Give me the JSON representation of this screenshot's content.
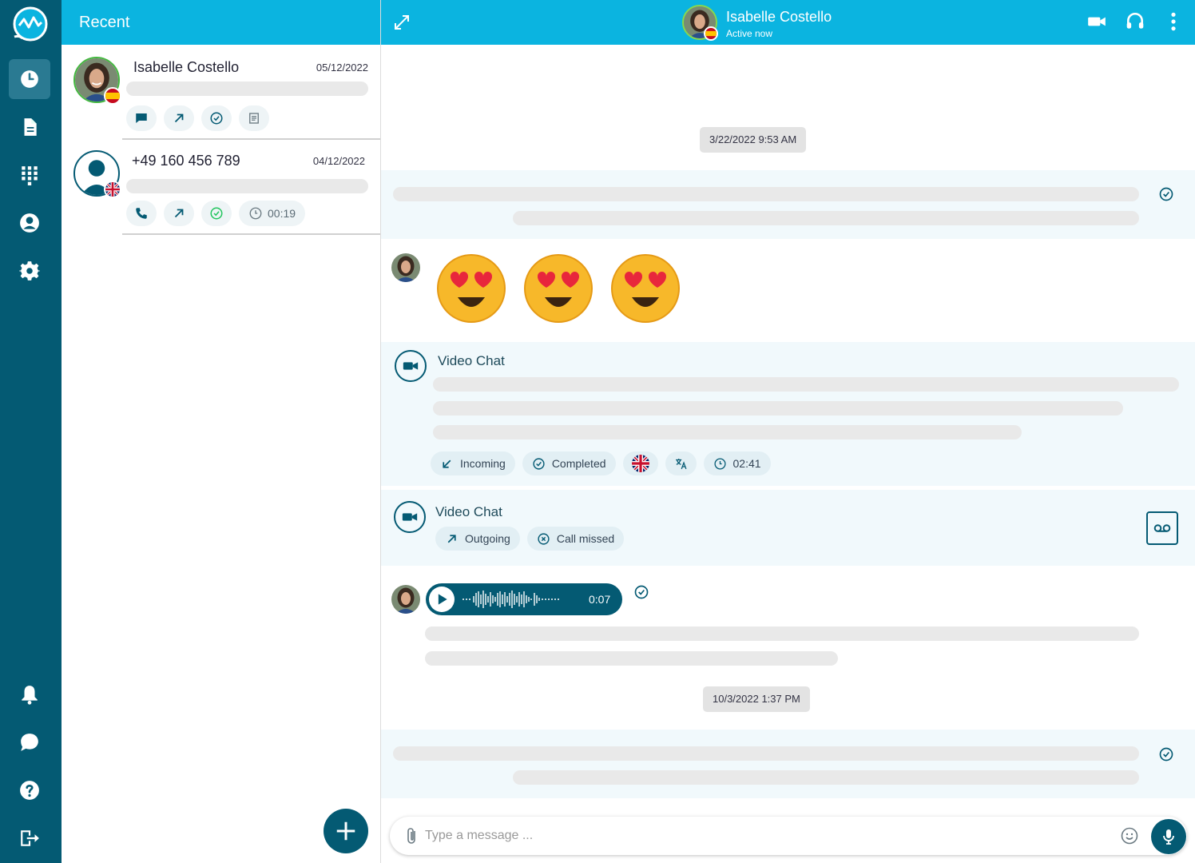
{
  "sidebar": {
    "items": [
      "recent-icon",
      "document-icon",
      "dialpad-icon",
      "user-icon",
      "settings-icon"
    ],
    "bottom_items": [
      "bell-icon",
      "chat-icon",
      "help-icon",
      "logout-icon"
    ]
  },
  "recent": {
    "title": "Recent",
    "contacts": [
      {
        "name": "Isabelle Costello",
        "date": "05/12/2022"
      },
      {
        "name": "+49 160 456 789",
        "date": "04/12/2022",
        "duration": "00:19"
      }
    ]
  },
  "chat": {
    "contact_name": "Isabelle Costello",
    "status": "Active now",
    "date_1": "3/22/2022 9:53 AM",
    "date_2": "10/3/2022 1:37 PM",
    "call_1": {
      "title": "Video Chat",
      "direction": "Incoming",
      "result": "Completed",
      "duration": "02:41"
    },
    "call_2": {
      "title": "Video Chat",
      "direction": "Outgoing",
      "result": "Call missed"
    },
    "audio_duration": "0:07",
    "input_placeholder": "Type a message ..."
  },
  "colors": {
    "rail": "#045a73",
    "header": "#0bb4e0",
    "band": "#f1f9fc",
    "accent_green": "#22c55e"
  }
}
